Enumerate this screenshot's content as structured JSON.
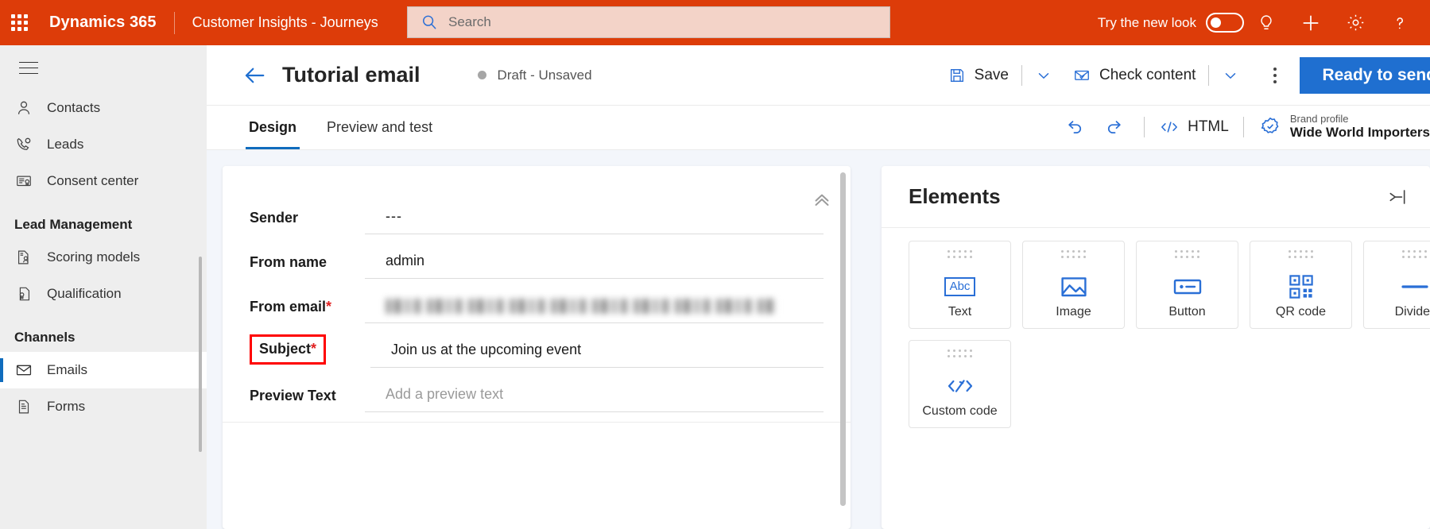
{
  "topbar": {
    "waffle_label": "app-launcher",
    "brand": "Dynamics 365",
    "app_name": "Customer Insights - Journeys",
    "search_placeholder": "Search",
    "search_value": "",
    "new_look_label": "Try the new look",
    "new_look_on": false,
    "icons": [
      "lightbulb-icon",
      "plus-icon",
      "gear-icon",
      "help-icon"
    ],
    "accent_color": "#dd3c09",
    "search_bg": "#f3d3c8"
  },
  "sidebar": {
    "items": [
      {
        "label": "Contacts",
        "icon": "contact-person-icon",
        "selected": false
      },
      {
        "label": "Leads",
        "icon": "phone-lead-icon",
        "selected": false
      },
      {
        "label": "Consent center",
        "icon": "consent-document-icon",
        "selected": false
      }
    ],
    "groups": [
      {
        "title": "Lead Management",
        "items": [
          {
            "label": "Scoring models",
            "icon": "scoring-model-icon",
            "selected": false
          },
          {
            "label": "Qualification",
            "icon": "qualification-icon",
            "selected": false
          }
        ]
      },
      {
        "title": "Channels",
        "items": [
          {
            "label": "Emails",
            "icon": "envelope-icon",
            "selected": true
          },
          {
            "label": "Forms",
            "icon": "form-document-icon",
            "selected": false
          }
        ]
      }
    ],
    "selected_accent": "#0f6cbd"
  },
  "command_bar": {
    "back_label": "back-arrow",
    "record_title": "Tutorial email",
    "status": "Draft - Unsaved",
    "save_label": "Save",
    "check_content_label": "Check content",
    "more_label": "more-commands",
    "primary_label": "Ready to send",
    "primary_color": "#1f6fd0"
  },
  "tabs": {
    "items": [
      {
        "label": "Design",
        "active": true
      },
      {
        "label": "Preview and test",
        "active": false
      }
    ],
    "undo_label": "undo-icon",
    "redo_label": "redo-icon",
    "html_label": "HTML",
    "brand_profile_label": "Brand profile",
    "brand_profile_value": "Wide World Importers"
  },
  "email_form": {
    "fields": [
      {
        "label": "Sender",
        "required": false,
        "value": "---",
        "placeholder": "",
        "state": "value",
        "highlighted": false
      },
      {
        "label": "From name",
        "required": false,
        "value": "admin",
        "placeholder": "",
        "state": "value",
        "highlighted": false
      },
      {
        "label": "From email",
        "required": true,
        "value": "",
        "placeholder": "",
        "state": "redacted",
        "highlighted": false
      },
      {
        "label": "Subject",
        "required": true,
        "value": "Join us at the upcoming event",
        "placeholder": "",
        "state": "value",
        "highlighted": true
      },
      {
        "label": "Preview Text",
        "required": false,
        "value": "",
        "placeholder": "Add a preview text",
        "state": "placeholder",
        "highlighted": false
      }
    ],
    "collapse_label": "collapse-header-icon",
    "highlight_color": "#ff0000",
    "required_color": "#e02020"
  },
  "elements_panel": {
    "title": "Elements",
    "collapse_label": "expand-panel-icon",
    "tiles": [
      {
        "label": "Text",
        "icon": "text-abc-icon"
      },
      {
        "label": "Image",
        "icon": "image-icon"
      },
      {
        "label": "Button",
        "icon": "button-icon"
      },
      {
        "label": "QR code",
        "icon": "qr-code-icon"
      },
      {
        "label": "Divider",
        "icon": "divider-icon"
      },
      {
        "label": "Custom code",
        "icon": "custom-code-icon"
      }
    ],
    "icon_color": "#2a6fd6"
  }
}
